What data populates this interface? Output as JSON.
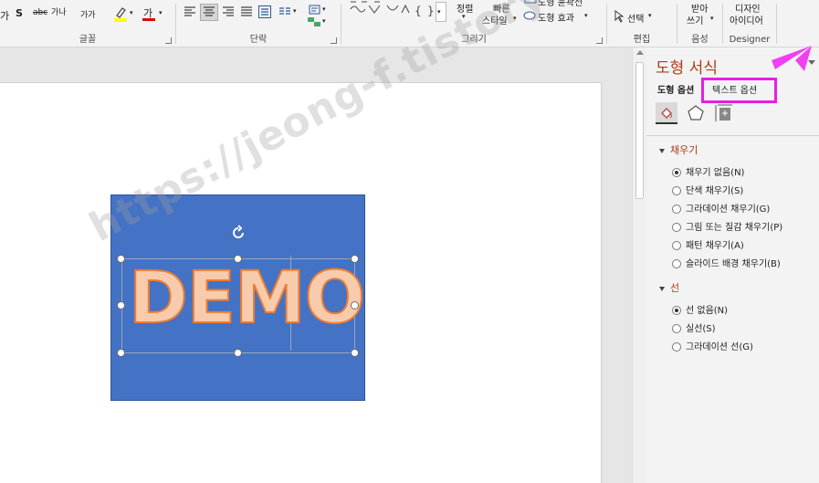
{
  "ribbon": {
    "font_group": {
      "label": "글꼴",
      "strike": "abc",
      "spacing": "가나",
      "case": "가가",
      "font_color_glyph": "가",
      "s_glyph": "S",
      "gha": "가"
    },
    "paragraph_group": {
      "label": "단락"
    },
    "drawing_group": {
      "label": "그리기",
      "arrange": "정렬",
      "quick_styles_line1": "빠른",
      "quick_styles_line2": "스타일",
      "shape_outline": "도형 윤곽선",
      "shape_effects": "도형 효과"
    },
    "editing_group": {
      "label": "편집",
      "select": "선택"
    },
    "voice_group": {
      "label": "음성",
      "dictate_line1": "받아",
      "dictate_line2": "쓰기"
    },
    "designer_group": {
      "label": "Designer",
      "ideas_line1": "디자인",
      "ideas_line2": "아이디어"
    }
  },
  "slide": {
    "text": "DEMO"
  },
  "watermark": "https://jeong-f.tistory.com",
  "pane": {
    "title": "도형 서식",
    "tabs": {
      "shape_options": "도형 옵션",
      "text_options": "텍스트 옵션"
    },
    "fill": {
      "heading": "채우기",
      "options": [
        "채우기 없음(N)",
        "단색 채우기(S)",
        "그라데이션 채우기(G)",
        "그림 또는 질감 채우기(P)",
        "패턴 채우기(A)",
        "슬라이드 배경 채우기(B)"
      ]
    },
    "line": {
      "heading": "선",
      "options": [
        "선 없음(N)",
        "실선(S)",
        "그라데이션 선(G)"
      ]
    }
  },
  "colors": {
    "shape_fill": "#4472c4",
    "text_fill": "#f8cbad",
    "text_outline": "#ed7d31",
    "pane_accent": "#b33a19",
    "highlight": "#e61ee6"
  }
}
